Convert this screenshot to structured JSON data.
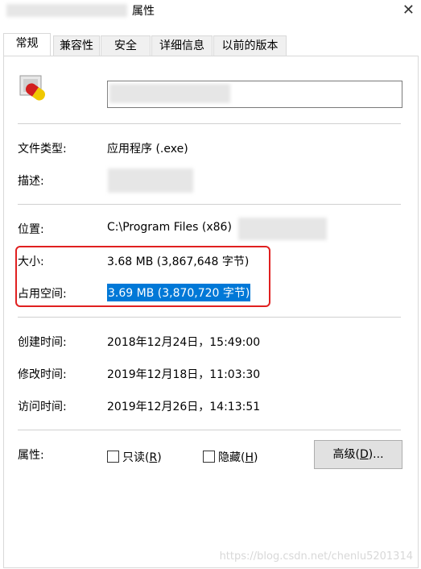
{
  "window": {
    "title": "属性",
    "close_glyph": "✕"
  },
  "tabs": [
    {
      "label": "常规",
      "active": true
    },
    {
      "label": "兼容性",
      "active": false
    },
    {
      "label": "安全",
      "active": false
    },
    {
      "label": "详细信息",
      "active": false
    },
    {
      "label": "以前的版本",
      "active": false
    }
  ],
  "general": {
    "file_name": "",
    "icon": "pill-capsule-icon",
    "type_label": "文件类型:",
    "type_value": "应用程序 (.exe)",
    "desc_label": "描述:",
    "desc_value": "",
    "location_label": "位置:",
    "location_value": "C:\\Program Files (x86)",
    "size_label": "大小:",
    "size_value": "3.68 MB (3,867,648 字节)",
    "disk_label": "占用空间:",
    "disk_value": "3.69 MB (3,870,720 字节)",
    "created_label": "创建时间:",
    "created_value": "2018年12月24日，15:49:00",
    "modified_label": "修改时间:",
    "modified_value": "2019年12月18日，11:03:30",
    "accessed_label": "访问时间:",
    "accessed_value": "2019年12月26日，14:13:51",
    "attr_label": "属性:",
    "readonly_label": "只读(",
    "readonly_key": "R",
    "readonly_end": ")",
    "readonly_checked": false,
    "hidden_label": "隐藏(",
    "hidden_key": "H",
    "hidden_end": ")",
    "hidden_checked": false,
    "advanced_label": "高级(",
    "advanced_key": "D",
    "advanced_end": ")..."
  },
  "colors": {
    "selection": "#0078d7",
    "annotation_box": "#e02020"
  },
  "watermark": "https://blog.csdn.net/chenlu5201314"
}
